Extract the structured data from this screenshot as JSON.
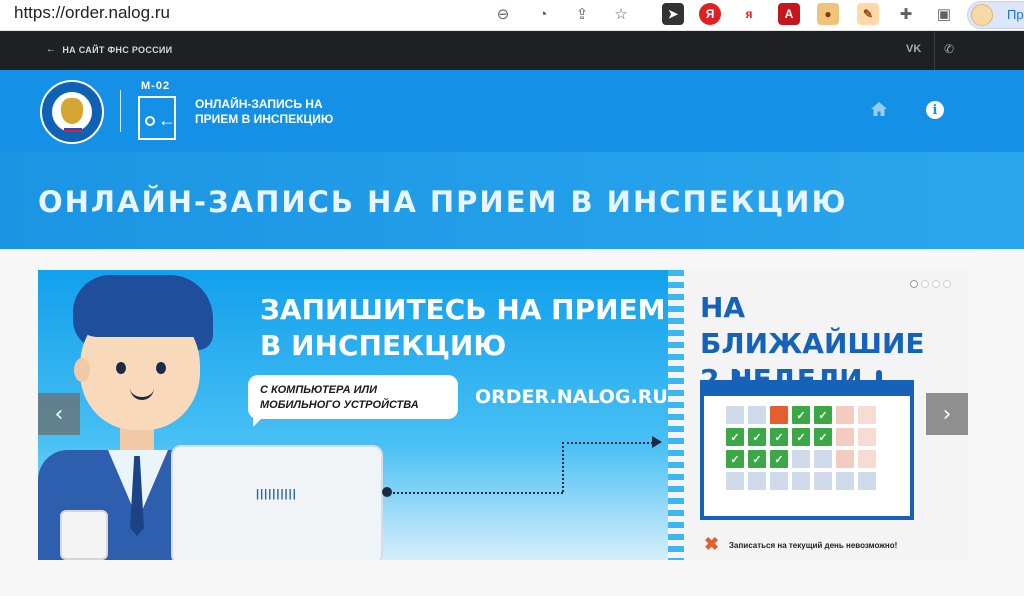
{
  "browser": {
    "url": "https://order.nalog.ru",
    "profile_label": "Пр"
  },
  "topnav": {
    "back_label": "НА САЙТ ФНС РОССИИ",
    "vk_label": "VK"
  },
  "header": {
    "form_code": "М-02",
    "brand_line1": "ОНЛАЙН-ЗАПИСЬ НА",
    "brand_line2": "ПРИЕМ В ИНСПЕКЦИЮ"
  },
  "banner": {
    "title": "ОНЛАЙН-ЗАПИСЬ НА ПРИЕМ В ИНСПЕКЦИЮ"
  },
  "slide": {
    "headline_line1": "ЗАПИШИТЕСЬ НА ПРИЕМ",
    "headline_line2": "В ИНСПЕКЦИЮ",
    "bubble_line1": "С КОМПЬЮТЕРА ИЛИ",
    "bubble_line2": "МОБИЛЬНОГО УСТРОЙСТВА",
    "site": "ORDER.NALOG.RU",
    "laptop_logo": "||||||||||",
    "weeks_line1": "НА БЛИЖАЙШИЕ",
    "weeks_line2": "2 НЕДЕЛИ",
    "warning_icon": "✖",
    "warning": "Записаться на текущий день невозможно!",
    "calendar": [
      [
        "grey",
        "grey",
        "orange",
        "green",
        "green",
        "pink",
        "lpink"
      ],
      [
        "green",
        "green",
        "green",
        "green",
        "green",
        "pink",
        "lpink"
      ],
      [
        "green",
        "green",
        "green",
        "grey",
        "grey",
        "pink",
        "lpink"
      ],
      [
        "grey",
        "grey",
        "grey",
        "grey",
        "grey",
        "grey",
        "grey"
      ]
    ]
  },
  "slider": {
    "prev_label": "‹",
    "next_label": "›",
    "dots": 4,
    "active_dot": 0
  },
  "colors": {
    "header_blue": "#1490e6",
    "topnav_dark": "#1f2023",
    "accent_orange": "#e55e2e",
    "calendar_blue": "#1562b8"
  }
}
